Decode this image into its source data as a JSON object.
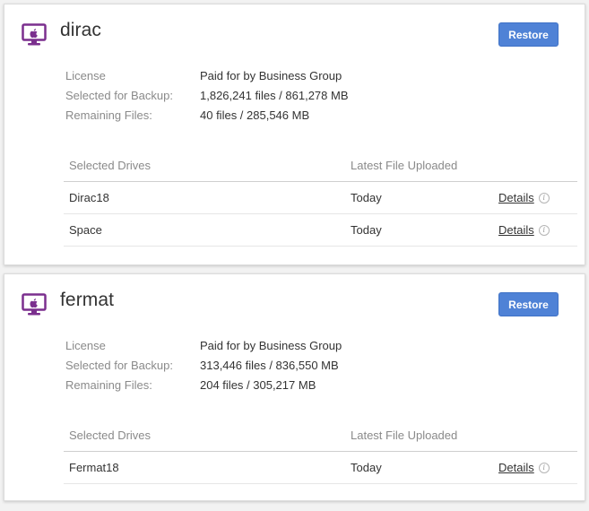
{
  "colors": {
    "accent": "#4f82d6",
    "icon_purple": "#7b2f8e"
  },
  "labels": {
    "license": "License",
    "selected_for_backup": "Selected for Backup:",
    "remaining_files": "Remaining Files:",
    "selected_drives": "Selected Drives",
    "latest_file_uploaded": "Latest File Uploaded",
    "restore": "Restore",
    "details": "Details"
  },
  "computers": [
    {
      "name": "dirac",
      "icon": "mac-computer-icon",
      "license": "Paid for by Business Group",
      "selected_for_backup": "1,826,241 files / 861,278 MB",
      "remaining_files": "40 files / 285,546 MB",
      "drives": [
        {
          "name": "Dirac18",
          "latest": "Today"
        },
        {
          "name": "Space",
          "latest": "Today"
        }
      ]
    },
    {
      "name": "fermat",
      "icon": "mac-computer-icon",
      "license": "Paid for by Business Group",
      "selected_for_backup": "313,446 files / 836,550 MB",
      "remaining_files": "204 files / 305,217 MB",
      "drives": [
        {
          "name": "Fermat18",
          "latest": "Today"
        }
      ]
    }
  ]
}
